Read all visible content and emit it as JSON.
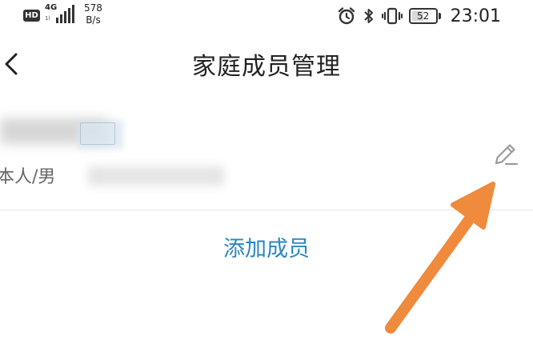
{
  "status_bar": {
    "hd_label": "HD",
    "network_label": "4G",
    "network_sub_label": "1l",
    "speed_value": "578",
    "speed_unit": "B/s",
    "battery_level": "52",
    "battery_fraction": 0.52,
    "time": "23:01",
    "icons": [
      "alarm-icon",
      "bluetooth-icon",
      "vibrate-icon",
      "battery-icon"
    ]
  },
  "nav_bar": {
    "back_icon": "chevron-left-icon",
    "title": "家庭成员管理"
  },
  "member": {
    "relation_label": "本人/男",
    "edit_icon": "pencil-icon"
  },
  "actions": {
    "add_member_label": "添加成员"
  },
  "colors": {
    "accent": "#2a86c0",
    "annotation_arrow": "#f08a3c",
    "divider": "#e6e6e6",
    "edit_icon": "#9a9a9a"
  }
}
